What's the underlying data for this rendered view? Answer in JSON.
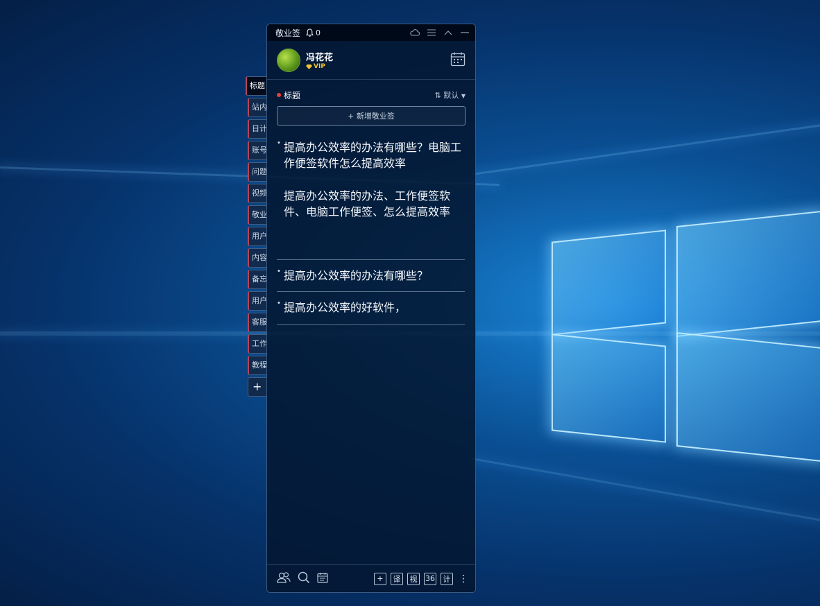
{
  "window": {
    "app_title": "敬业签",
    "notification_count": "0",
    "controls": [
      "cloud-icon",
      "menu-icon",
      "collapse-icon",
      "minimize-icon"
    ]
  },
  "user": {
    "name": "冯花花",
    "badge": "VIP"
  },
  "category": {
    "title": "标题",
    "sort_label": "默认",
    "add_button": "+ 新增敬业签"
  },
  "notes": [
    {
      "line1": "提高办公效率的办法有哪些？电脑工作便签软件怎么提高效率",
      "line2": "提高办公效率的办法、工作便签软件、电脑工作便签、怎么提高效率"
    },
    {
      "line1": "提高办公效率的办法有哪些？"
    },
    {
      "line1": "提高办公效率的好软件，"
    }
  ],
  "side_tabs": [
    "标题",
    "站内",
    "日计",
    "账号",
    "问题",
    "视频",
    "敬业",
    "用户",
    "内容",
    "备忘",
    "用户",
    "客服",
    "工作",
    "教程"
  ],
  "side_add": "+",
  "bottom_bar": {
    "left_icons": [
      "contacts-icon",
      "search-icon",
      "calendar-list-icon"
    ],
    "buttons": [
      "+",
      "译",
      "视",
      "36",
      "计"
    ],
    "more": "⋮"
  },
  "colors": {
    "accent_red": "#e8403a",
    "vip_gold": "#f3c433",
    "window_bg": "#041630"
  }
}
